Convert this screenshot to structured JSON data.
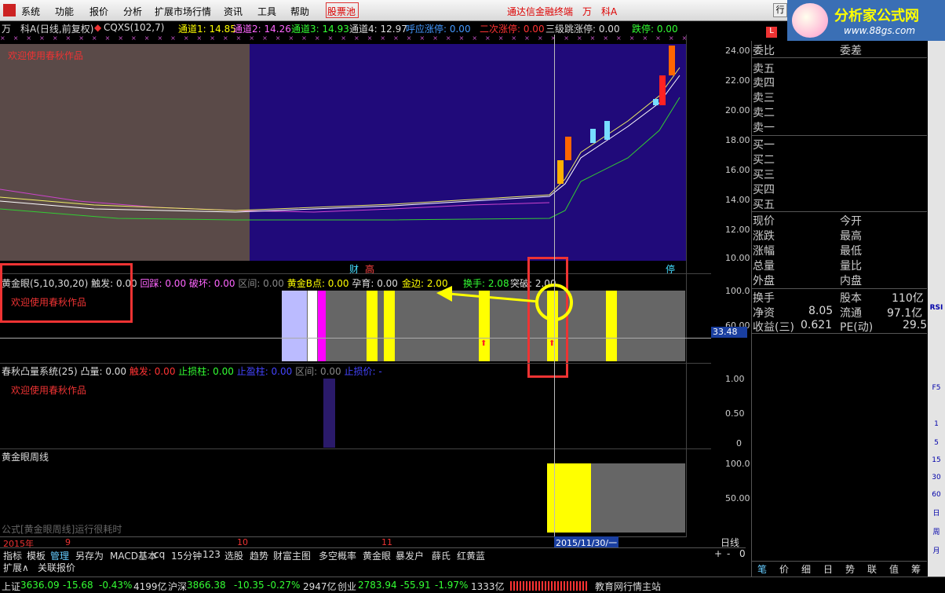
{
  "menu": {
    "items": [
      "系统",
      "功能",
      "报价",
      "分析",
      "扩展市场行情",
      "资讯",
      "工具",
      "帮助"
    ],
    "stock_pool": "股票池",
    "center_title": "通达信金融终端",
    "center_stock": "万　科A",
    "right_btn": "行"
  },
  "logo": {
    "title": "分析家公式网",
    "url": "www.88gs.com"
  },
  "infobar": {
    "stock": "万　科A(日线,前复权)",
    "indicator": "CQXS(102,7)",
    "ch1": "通道1: 14.85",
    "ch2": "通道2: 14.26",
    "ch3": "通道3: 14.93",
    "ch4": "通道4: 12.97",
    "limit1": "呼应涨停: 0.00",
    "limit2": "二次涨停: 0.00",
    "limit3": "三级跳涨停: 0.00",
    "limit4": "跌停: 0.00"
  },
  "main": {
    "welcome": "欢迎使用春秋作品",
    "marks": {
      "cai": "财",
      "gao": "高",
      "ting": "停"
    }
  },
  "price_axis": [
    "24.00",
    "22.00",
    "20.00",
    "18.00",
    "16.00",
    "14.00",
    "12.00",
    "10.00"
  ],
  "panel1": {
    "name": "黄金眼(5,10,30,20)",
    "fields": [
      "触发: 0.00",
      "回踩: 0.00",
      "破坏: 0.00",
      "区间: 0.00",
      "黄金B点: 0.00",
      "孕育: 0.00",
      "金边: 2.00",
      "换手: 2.08",
      "突破: 2.00"
    ],
    "welcome": "欢迎使用春秋作品",
    "axis": [
      "100.0",
      "60.00"
    ],
    "current": "33.48"
  },
  "panel2": {
    "name": "春秋凸量系统(25)",
    "fields": [
      "凸量: 0.00",
      "触发: 0.00",
      "止损柱: 0.00",
      "止盈柱: 0.00",
      "区间: 0.00",
      "止损价: -"
    ],
    "welcome": "欢迎使用春秋作品",
    "axis": [
      "1.00",
      "0.50",
      "0"
    ]
  },
  "panel3": {
    "name": "黄金眼周线",
    "status": "公式[黄金眼周线]运行很耗时",
    "axis": [
      "100.0",
      "50.00"
    ]
  },
  "xaxis": {
    "labels": [
      "2015年",
      "9",
      "10",
      "11"
    ],
    "cursor_date": "2015/11/30/一",
    "period": "日线"
  },
  "tabs": [
    "指标",
    "模板",
    "管理",
    "另存为",
    "MACD基本",
    "cq",
    "15分钟",
    "123",
    "选股",
    "趋势",
    "财富主图",
    "多空概率",
    "黄金眼",
    "暴发户",
    "薛氏",
    "红黄蓝"
  ],
  "tabs_row2": [
    "扩展∧",
    "关联报价"
  ],
  "tab_ctrls": [
    "+",
    "-",
    "0"
  ],
  "right_panel": {
    "header": [
      "委比",
      "委差"
    ],
    "sells": [
      "卖五",
      "卖四",
      "卖三",
      "卖二",
      "卖一"
    ],
    "buys": [
      "买一",
      "买二",
      "买三",
      "买四",
      "买五"
    ],
    "stats_left": [
      "现价",
      "涨跌",
      "涨幅",
      "总量",
      "外盘"
    ],
    "stats_right": [
      "今开",
      "最高",
      "最低",
      "量比",
      "内盘"
    ],
    "bottom": [
      {
        "l": "换手",
        "lv": "",
        "r": "股本",
        "rv": "110亿"
      },
      {
        "l": "净资",
        "lv": "8.05",
        "r": "流通",
        "rv": "97.1亿"
      },
      {
        "l": "收益(三)",
        "lv": "0.621",
        "r": "PE(动)",
        "rv": "29.5"
      }
    ],
    "tabs": [
      "笔",
      "价",
      "细",
      "日",
      "势",
      "联",
      "值",
      "筹"
    ]
  },
  "toolbar": [
    "RSI",
    "F5",
    "1",
    "5",
    "15",
    "30",
    "60",
    "日",
    "周",
    "月"
  ],
  "status": {
    "sh_label": "上证",
    "sh": "3636.09",
    "sh_chg": "-15.68",
    "sh_pct": "-0.43%",
    "sh_vol": "4199亿",
    "sz_label": "沪深",
    "sz": "3866.38",
    "sz_chg": "-10.35",
    "sz_pct": "-0.27%",
    "sz_vol": "2947亿",
    "cy_label": "创业",
    "cy": "2783.94",
    "cy_chg": "-55.91",
    "cy_pct": "-1.97%",
    "cy_vol": "1333亿",
    "site": "教育网行情主站"
  }
}
